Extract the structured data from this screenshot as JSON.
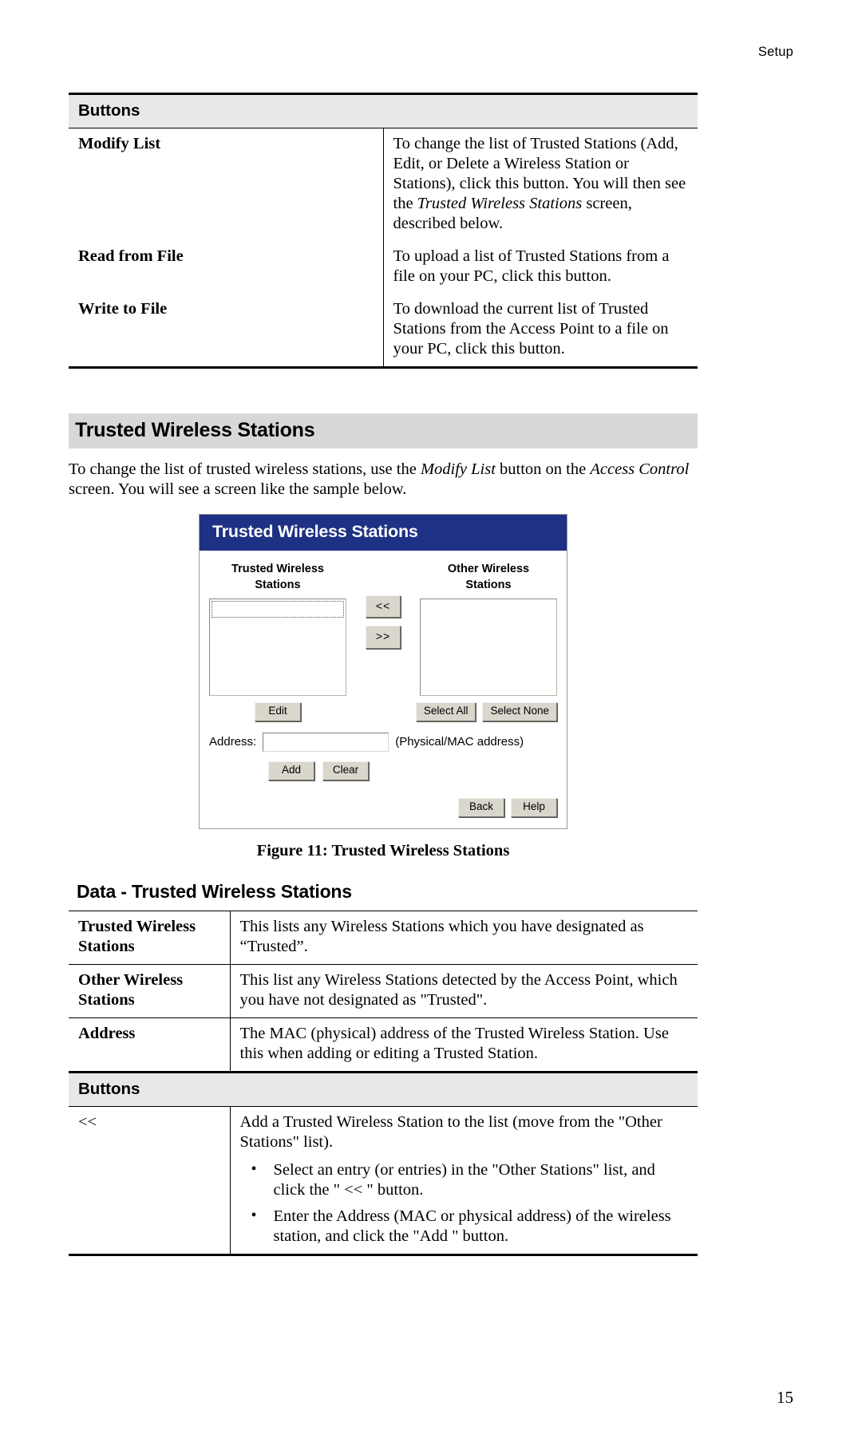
{
  "header": {
    "running_head": "Setup"
  },
  "buttons_table_1": {
    "section_title": "Buttons",
    "rows": [
      {
        "label": "Modify List",
        "desc_pre": "To change the list of Trusted Stations (Add, Edit, or Delete a Wireless Station or Stations), click this button. You will then see the ",
        "desc_italic": "Trusted Wireless Stations",
        "desc_post": " screen, described below."
      },
      {
        "label": "Read from File",
        "desc_pre": "To upload a list of Trusted Stations from a file on your PC, click this button.",
        "desc_italic": "",
        "desc_post": ""
      },
      {
        "label": "Write to File",
        "desc_pre": "To download the current list of Trusted Stations from the Access Point to a file on your PC, click this button.",
        "desc_italic": "",
        "desc_post": ""
      }
    ]
  },
  "section": {
    "heading": "Trusted Wireless Stations",
    "intro_pre": "To change the list of trusted wireless stations, use the ",
    "intro_italic_1": "Modify List",
    "intro_mid": " button on the ",
    "intro_italic_2": "Access Control",
    "intro_post": " screen. You will see a screen like the sample below."
  },
  "dialog": {
    "title": "Trusted Wireless Stations",
    "trusted_list_title": "Trusted Wireless\nStations",
    "trusted_list_title_line1": "Trusted Wireless",
    "trusted_list_title_line2": "Stations",
    "other_list_title_line1": "Other Wireless",
    "other_list_title_line2": "Stations",
    "btn_move_left": "<<",
    "btn_move_right": ">>",
    "btn_edit": "Edit",
    "btn_select_all": "Select All",
    "btn_select_none": "Select None",
    "address_label": "Address:",
    "address_value": "",
    "address_hint": "(Physical/MAC address)",
    "btn_add": "Add",
    "btn_clear": "Clear",
    "btn_back": "Back",
    "btn_help": "Help",
    "title_bar_color": "#1f3184",
    "button_face_color": "#d9d6cc"
  },
  "figure": {
    "caption": "Figure 11: Trusted Wireless Stations"
  },
  "data_table": {
    "sub_heading": "Data - Trusted Wireless Stations",
    "rows": [
      {
        "label_line1": "Trusted Wireless",
        "label_line2": "Stations",
        "desc": "This lists any Wireless Stations which you have designated as “Trusted”."
      },
      {
        "label_line1": "Other Wireless",
        "label_line2": "Stations",
        "desc": "This list any Wireless Stations detected by the Access Point, which you have not designated as \"Trusted\"."
      },
      {
        "label_line1": "Address",
        "label_line2": "",
        "desc": "The MAC (physical) address of the Trusted Wireless Station. Use this when adding or editing a Trusted Station."
      }
    ],
    "buttons_section_title": "Buttons",
    "button_rows": [
      {
        "label": "<<",
        "desc": "Add a Trusted Wireless Station to the list (move from the \"Other Stations\" list).",
        "bullets": [
          "Select an entry (or entries) in the \"Other Stations\" list, and click the \" << \" button.",
          "Enter the Address (MAC or physical address) of the wireless station, and click the \"Add \" button."
        ]
      }
    ]
  },
  "footer": {
    "page_number": "15"
  }
}
